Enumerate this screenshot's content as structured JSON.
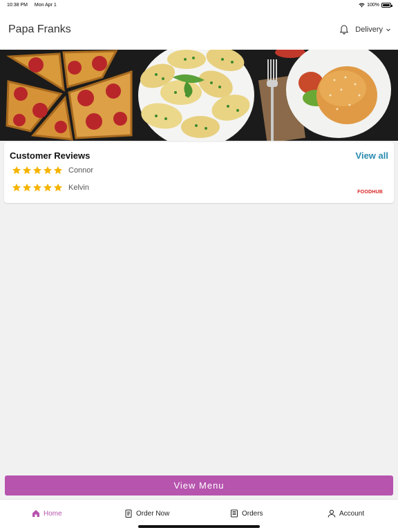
{
  "status_bar": {
    "time": "10:38 PM",
    "date": "Mon Apr 1",
    "battery": "100%"
  },
  "header": {
    "title": "Papa Franks",
    "mode_label": "Delivery"
  },
  "reviews": {
    "title": "Customer Reviews",
    "view_all_label": "View all",
    "items": [
      {
        "name": "Connor",
        "rating": 5
      },
      {
        "name": "Kelvin",
        "rating": 5
      }
    ],
    "brand": "FOODHUB"
  },
  "view_menu_label": "View Menu",
  "tabs": [
    {
      "label": "Home",
      "icon": "home-icon",
      "active": true
    },
    {
      "label": "Order Now",
      "icon": "order-icon",
      "active": false
    },
    {
      "label": "Orders",
      "icon": "receipt-icon",
      "active": false
    },
    {
      "label": "Account",
      "icon": "user-icon",
      "active": false
    }
  ],
  "colors": {
    "accent": "#b654ae",
    "link": "#2a8ab0",
    "star": "#f5b400",
    "brand": "#d8201f"
  }
}
